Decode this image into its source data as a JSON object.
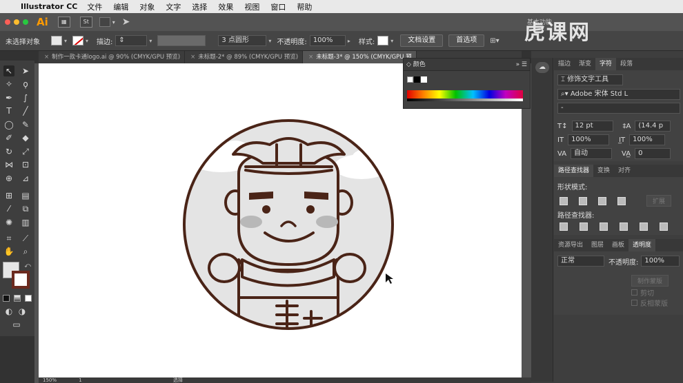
{
  "menubar": {
    "app_name": "Illustrator CC",
    "items": [
      "文件",
      "编辑",
      "对象",
      "文字",
      "选择",
      "效果",
      "视图",
      "窗口",
      "帮助"
    ]
  },
  "appbar": {
    "logo": "Ai",
    "st_label": "St",
    "workspace": "基本功能"
  },
  "control": {
    "no_selection": "未选择对象",
    "stroke_label": "描边:",
    "brush_label": "3 点圆形",
    "opacity_label": "不透明度:",
    "opacity_value": "100%",
    "style_label": "样式:",
    "doc_setup": "文档设置",
    "preferences": "首选项"
  },
  "tabs": [
    {
      "label": "制作一款卡通logo.ai @ 90% (CMYK/GPU 预览)",
      "active": false
    },
    {
      "label": "未标题-2* @ 89% (CMYK/GPU 预览)",
      "active": false
    },
    {
      "label": "未标题-3* @ 150% (CMYK/GPU 预",
      "active": true
    }
  ],
  "color_panel": {
    "title": "颜色"
  },
  "character_panel": {
    "tabs": [
      "描边",
      "渐变",
      "字符",
      "段落"
    ],
    "active_tab": "字符",
    "touch_type": "修饰文字工具",
    "font_family": "Adobe 宋体 Std L",
    "font_style": "-",
    "font_size": "12 pt",
    "leading": "(14.4 p",
    "vscale": "100%",
    "hscale": "100%",
    "kerning": "自动",
    "tracking": "0"
  },
  "pathfinder_panel": {
    "tabs": [
      "路径查找器",
      "变换",
      "对齐"
    ],
    "shape_modes": "形状模式:",
    "expand": "扩展",
    "pathfinders": "路径查找器:"
  },
  "transparency_panel": {
    "tabs": [
      "资源导出",
      "图层",
      "画板",
      "透明度"
    ],
    "blend_mode": "正常",
    "opacity_label": "不透明度:",
    "opacity_value": "100%",
    "make_mask": "制作蒙版",
    "clip": "剪切",
    "invert": "反相蒙版"
  },
  "status": {
    "zoom": "150%",
    "artboard": "1",
    "tool": "选择"
  },
  "watermark": "虎课网",
  "colors": {
    "accent": "#ff9a00",
    "outline": "#4a2417",
    "fill_light": "#e4e4e4",
    "cheek": "#b8b8b8"
  }
}
